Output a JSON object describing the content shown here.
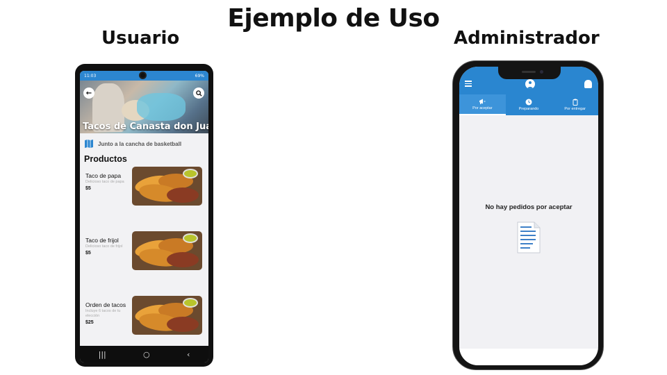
{
  "slide": {
    "title": "Ejemplo de Uso",
    "user_label": "Usuario",
    "admin_label": "Administrador"
  },
  "user_app": {
    "status_bar": {
      "time": "11:03",
      "battery": "69%"
    },
    "restaurant_name": "Tacos de Canasta don Juan",
    "location": "Junto a la cancha de basketball",
    "products_title": "Productos",
    "products": [
      {
        "name": "Taco de papa",
        "description": "Delicioso taco de papa",
        "price": "$5"
      },
      {
        "name": "Taco de frijol",
        "description": "Delicioso taco de frijol",
        "price": "$5"
      },
      {
        "name": "Orden de tacos",
        "description": "Incluye 6 tacos de tu elección",
        "price": "$25"
      }
    ],
    "nav": {
      "recents": "|||",
      "home": "○",
      "back": "‹"
    },
    "colors": {
      "header": "#2c86d0"
    }
  },
  "admin_app": {
    "tabs": [
      {
        "label": "Por aceptar",
        "icon": "megaphone-icon",
        "active": true
      },
      {
        "label": "Preparando",
        "icon": "clock-icon",
        "active": false
      },
      {
        "label": "Por entregar",
        "icon": "clipboard-icon",
        "active": false
      }
    ],
    "empty_message": "No hay pedidos por aceptar",
    "colors": {
      "header": "#2a86d0"
    }
  }
}
